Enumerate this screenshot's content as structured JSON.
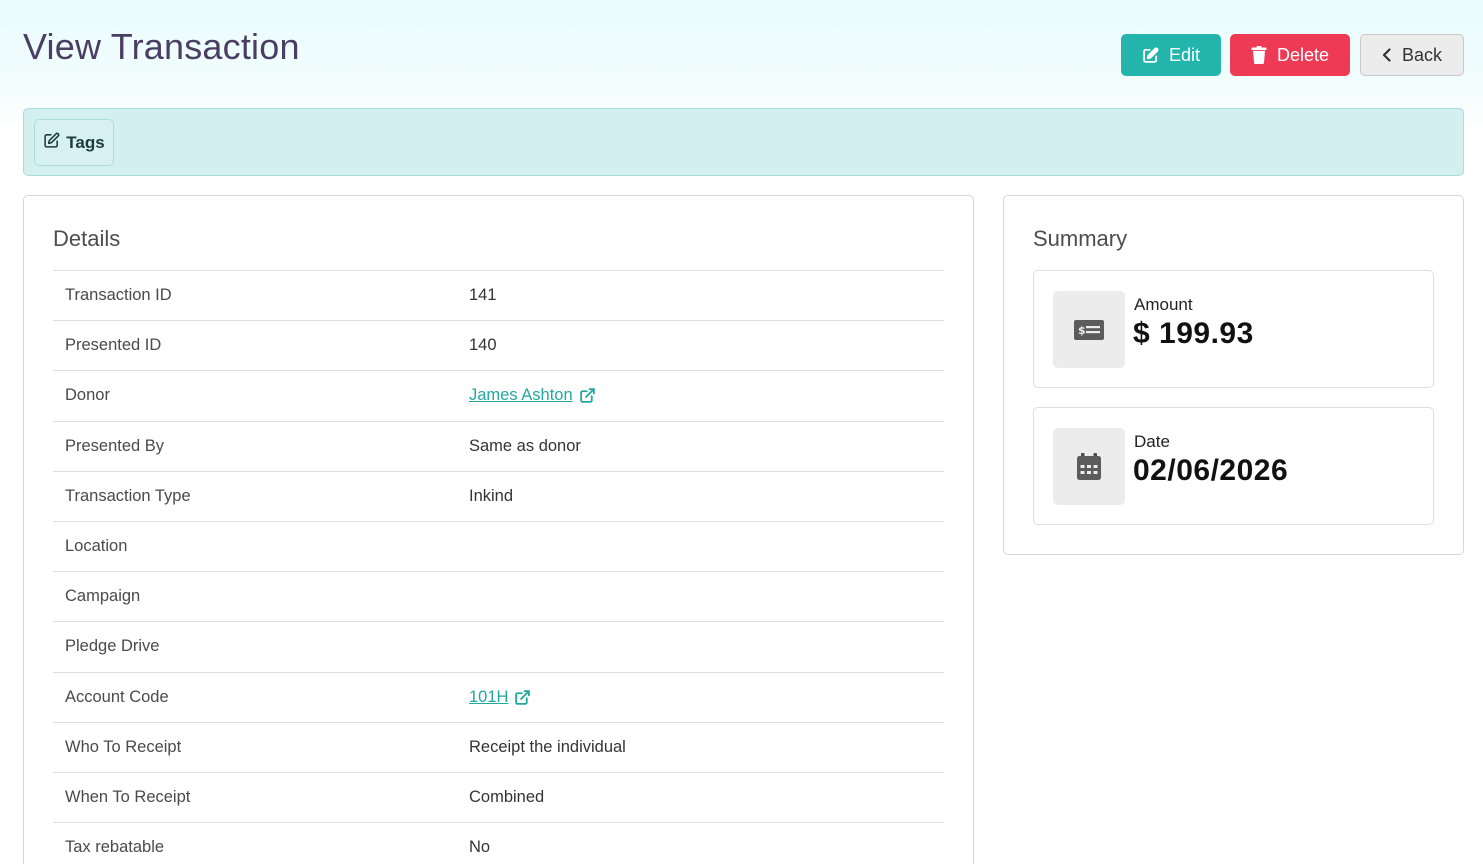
{
  "page": {
    "title": "View Transaction"
  },
  "actions": {
    "edit_label": "Edit",
    "delete_label": "Delete",
    "back_label": "Back"
  },
  "tags": {
    "label": "Tags"
  },
  "details": {
    "title": "Details",
    "rows": [
      {
        "label": "Transaction ID",
        "value": "141"
      },
      {
        "label": "Presented ID",
        "value": "140"
      },
      {
        "label": "Donor",
        "value": "James Ashton",
        "link": true
      },
      {
        "label": "Presented By",
        "value": "Same as donor"
      },
      {
        "label": "Transaction Type",
        "value": "Inkind"
      },
      {
        "label": "Location",
        "value": ""
      },
      {
        "label": "Campaign",
        "value": ""
      },
      {
        "label": "Pledge Drive",
        "value": ""
      },
      {
        "label": "Account Code",
        "value": "101H",
        "link": true
      },
      {
        "label": "Who To Receipt",
        "value": "Receipt the individual"
      },
      {
        "label": "When To Receipt",
        "value": "Combined"
      },
      {
        "label": "Tax rebatable",
        "value": "No"
      }
    ]
  },
  "summary": {
    "title": "Summary",
    "amount": {
      "label": "Amount",
      "value": "$ 199.93",
      "icon": "money-check-icon"
    },
    "date": {
      "label": "Date",
      "value": "02/06/2026",
      "icon": "calendar-icon"
    }
  },
  "colors": {
    "accent": "#23b5ab",
    "danger": "#ee3a55",
    "tags_bg": "#d3eff0",
    "title": "#4a3f63"
  }
}
